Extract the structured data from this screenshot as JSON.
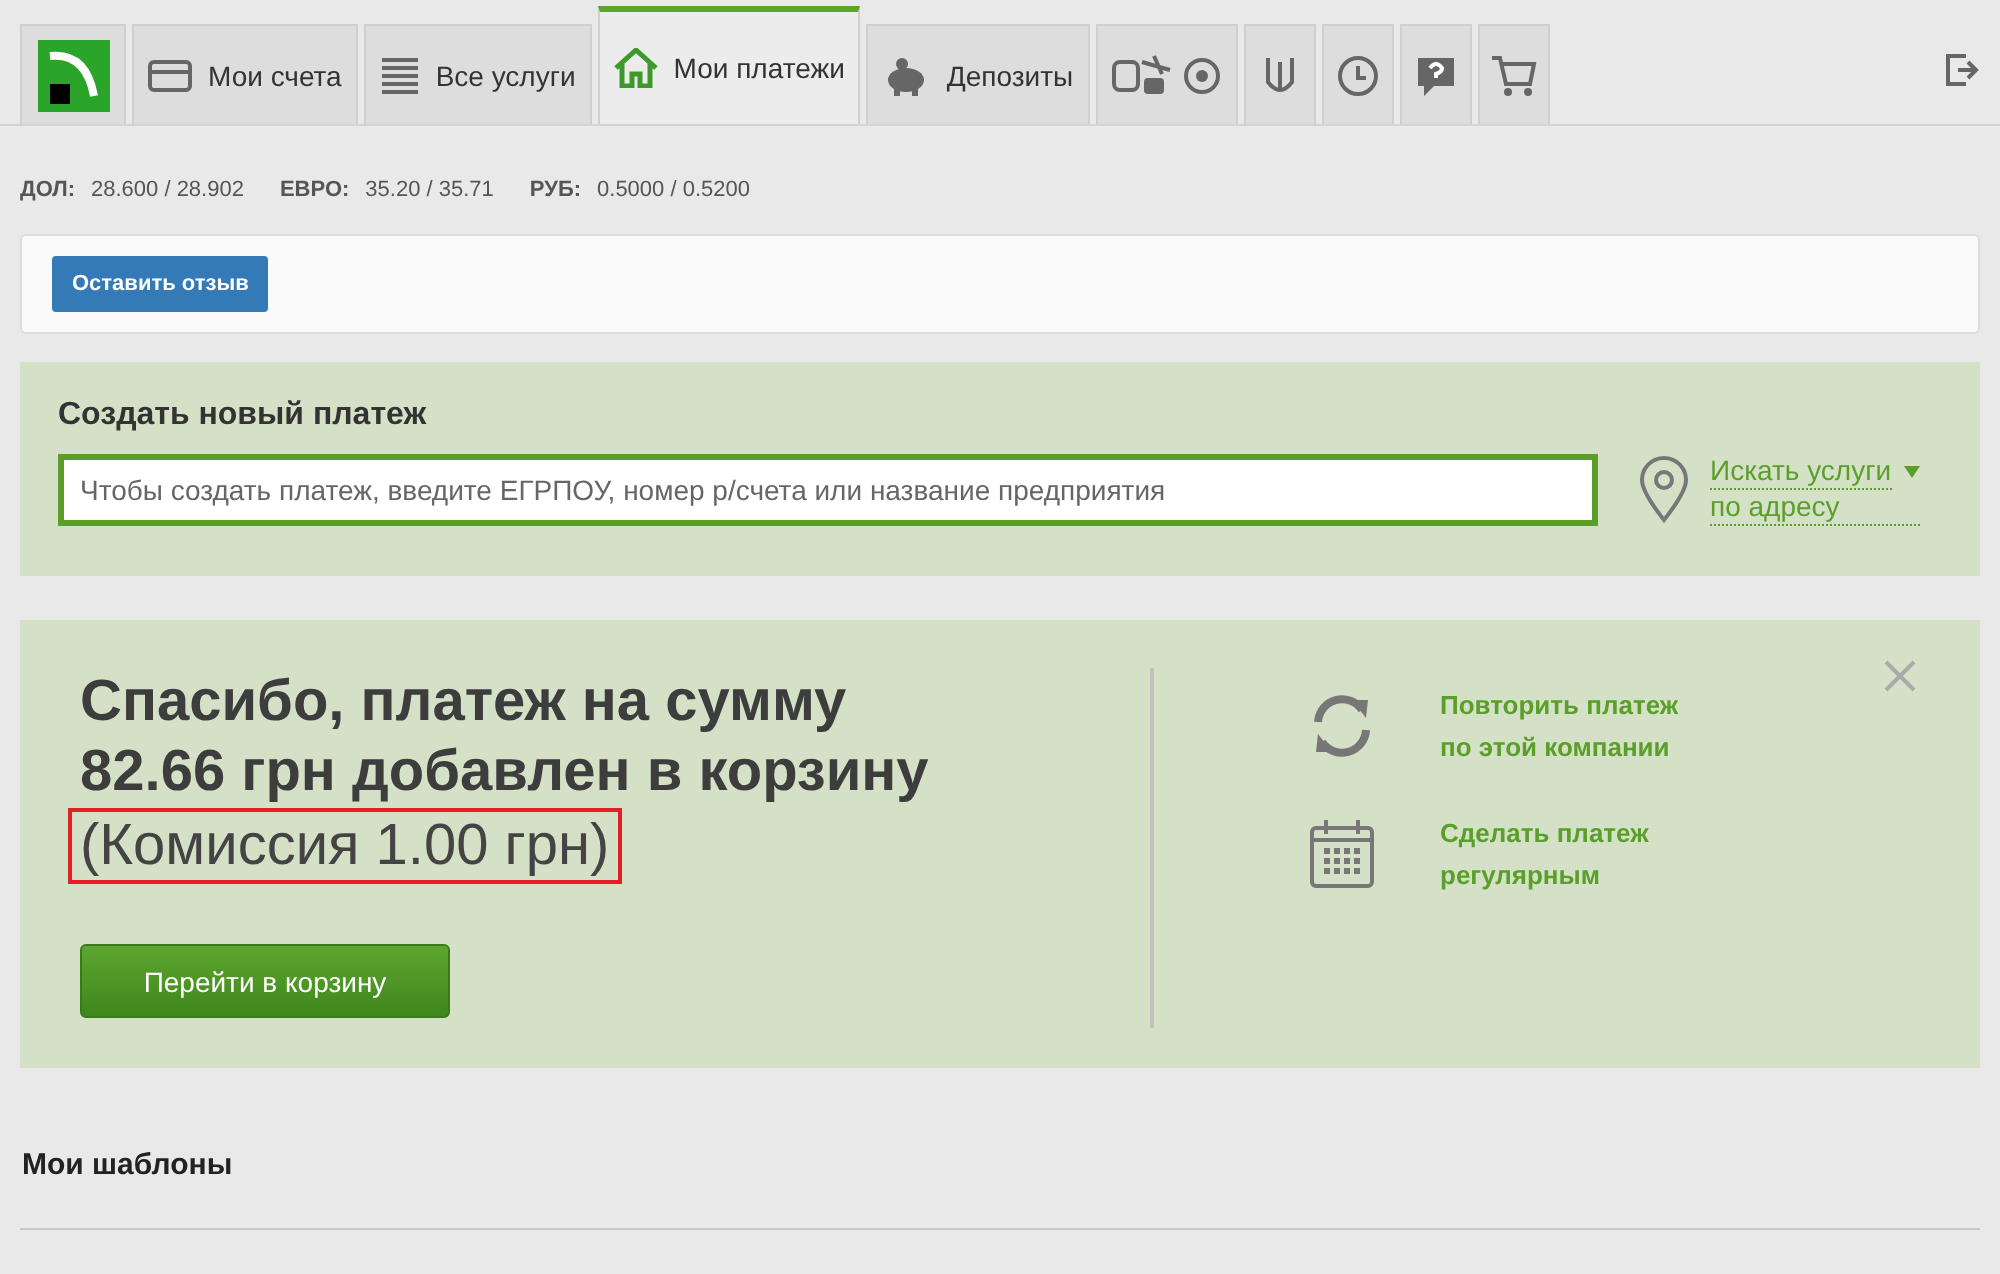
{
  "tabs": [
    {
      "label": "Мои счета",
      "kind": "card",
      "selected": false
    },
    {
      "label": "Все услуги",
      "kind": "list",
      "selected": false
    },
    {
      "label": "Мои платежи",
      "kind": "house",
      "selected": true
    },
    {
      "label": "Депозиты",
      "kind": "piggy",
      "selected": false
    }
  ],
  "rates": [
    {
      "currency": "ДОЛ:",
      "value": "28.600 / 28.902"
    },
    {
      "currency": "ЕВРО:",
      "value": "35.20 / 35.71"
    },
    {
      "currency": "РУБ:",
      "value": "0.5000 / 0.5200"
    }
  ],
  "feedback_button": "Оставить отзыв",
  "create_payment": {
    "title": "Создать новый платеж",
    "placeholder": "Чтобы создать платеж, введите ЕГРПОУ, номер р/счета или название предприятия",
    "address_link_line1": "Искать услуги",
    "address_link_line2": "по адресу"
  },
  "success": {
    "line1": "Спасибо,  платеж на сумму",
    "line2": "82.66 грн  добавлен в корзину",
    "commission": "(Комиссия 1.00 грн)",
    "commission_highlighted": true,
    "cart_button": "Перейти в корзину",
    "actions": [
      {
        "kind": "refresh",
        "line1": "Повторить платеж",
        "line2": "по этой компании"
      },
      {
        "kind": "calendar",
        "line1": "Сделать платеж",
        "line2": "регулярным"
      }
    ]
  },
  "templates_title": "Мои шаблоны"
}
